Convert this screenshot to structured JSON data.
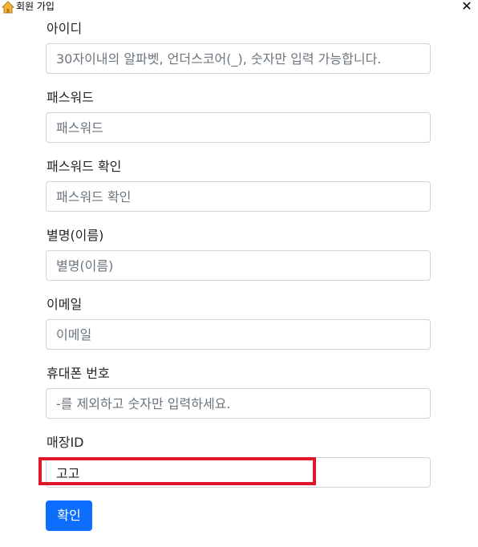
{
  "window": {
    "title": "회원 가입",
    "close_glyph": "✕",
    "icon": "home-icon"
  },
  "form": {
    "fields": [
      {
        "label": "아이디",
        "value": "",
        "placeholder": "30자이내의 알파벳, 언더스코어(_), 숫자만 입력 가능합니다."
      },
      {
        "label": "패스워드",
        "value": "",
        "placeholder": "패스워드"
      },
      {
        "label": "패스워드 확인",
        "value": "",
        "placeholder": "패스워드 확인"
      },
      {
        "label": "별명(이름)",
        "value": "",
        "placeholder": "별명(이름)"
      },
      {
        "label": "이메일",
        "value": "",
        "placeholder": "이메일"
      },
      {
        "label": "휴대폰 번호",
        "value": "",
        "placeholder": "-를 제외하고 숫자만 입력하세요."
      },
      {
        "label": "매장ID",
        "value": "고고",
        "placeholder": ""
      }
    ],
    "submit_label": "확인"
  },
  "colors": {
    "primary": "#0d6efd",
    "highlight": "#e0162b",
    "input_border": "#ced4da",
    "placeholder": "#6c757d"
  }
}
